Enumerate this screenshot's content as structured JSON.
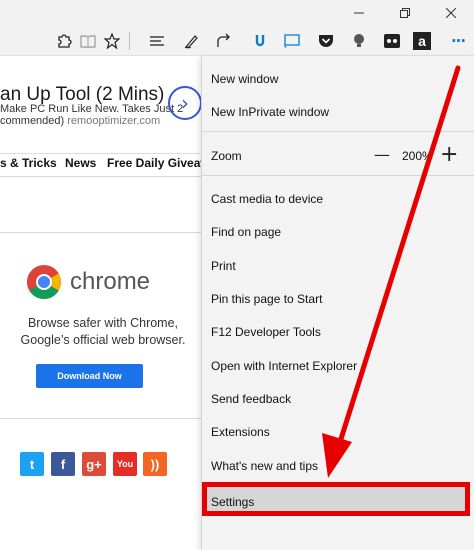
{
  "window": {
    "minimize_icon": "minimize-icon",
    "restore_icon": "restore-icon",
    "close_icon": "close-icon"
  },
  "toolbar": {
    "icons": [
      "puzzle-icon",
      "reading-view-icon",
      "favorite-star-icon",
      "hub-icon",
      "web-note-icon",
      "share-icon",
      "extension-blue-icon",
      "extension-cast-icon",
      "pocket-icon",
      "extension-lightbulb-icon",
      "extension-dark-icon",
      "amazon-icon",
      "more-icon"
    ],
    "amazon_label": "a",
    "more_label": "···"
  },
  "page": {
    "ad": {
      "title": "an Up Tool (2 Mins)",
      "line1": "Make PC Run Like New. Takes Just 2",
      "line2_prefix": "commended)",
      "line2_domain": "remooptimizer.com"
    },
    "nav": [
      "s & Tricks",
      "News",
      "Free Daily Giveaw"
    ],
    "chrome": {
      "word": "chrome",
      "desc1": "Browse safer with Chrome,",
      "desc2": "Google’s official web browser.",
      "download": "Download Now"
    },
    "social": [
      {
        "name": "twitter-icon",
        "glyph": "t",
        "color": "#1da1f2"
      },
      {
        "name": "facebook-icon",
        "glyph": "f",
        "color": "#3b5998"
      },
      {
        "name": "google-plus-icon",
        "glyph": "g+",
        "color": "#dd4b39"
      },
      {
        "name": "youtube-icon",
        "glyph": "You",
        "color": "#e52d27"
      },
      {
        "name": "rss-icon",
        "glyph": "))",
        "color": "#f26522"
      }
    ]
  },
  "menu": {
    "new_window": "New window",
    "new_inprivate": "New InPrivate window",
    "zoom_label": "Zoom",
    "zoom_minus": "—",
    "zoom_value": "200%",
    "zoom_plus": "+",
    "cast": "Cast media to device",
    "find": "Find on page",
    "print": "Print",
    "pin": "Pin this page to Start",
    "devtools": "F12 Developer Tools",
    "open_ie": "Open with Internet Explorer",
    "feedback": "Send feedback",
    "extensions": "Extensions",
    "whats_new": "What's new and tips",
    "settings": "Settings"
  },
  "annotation": {
    "arrow_color": "#e60000"
  }
}
